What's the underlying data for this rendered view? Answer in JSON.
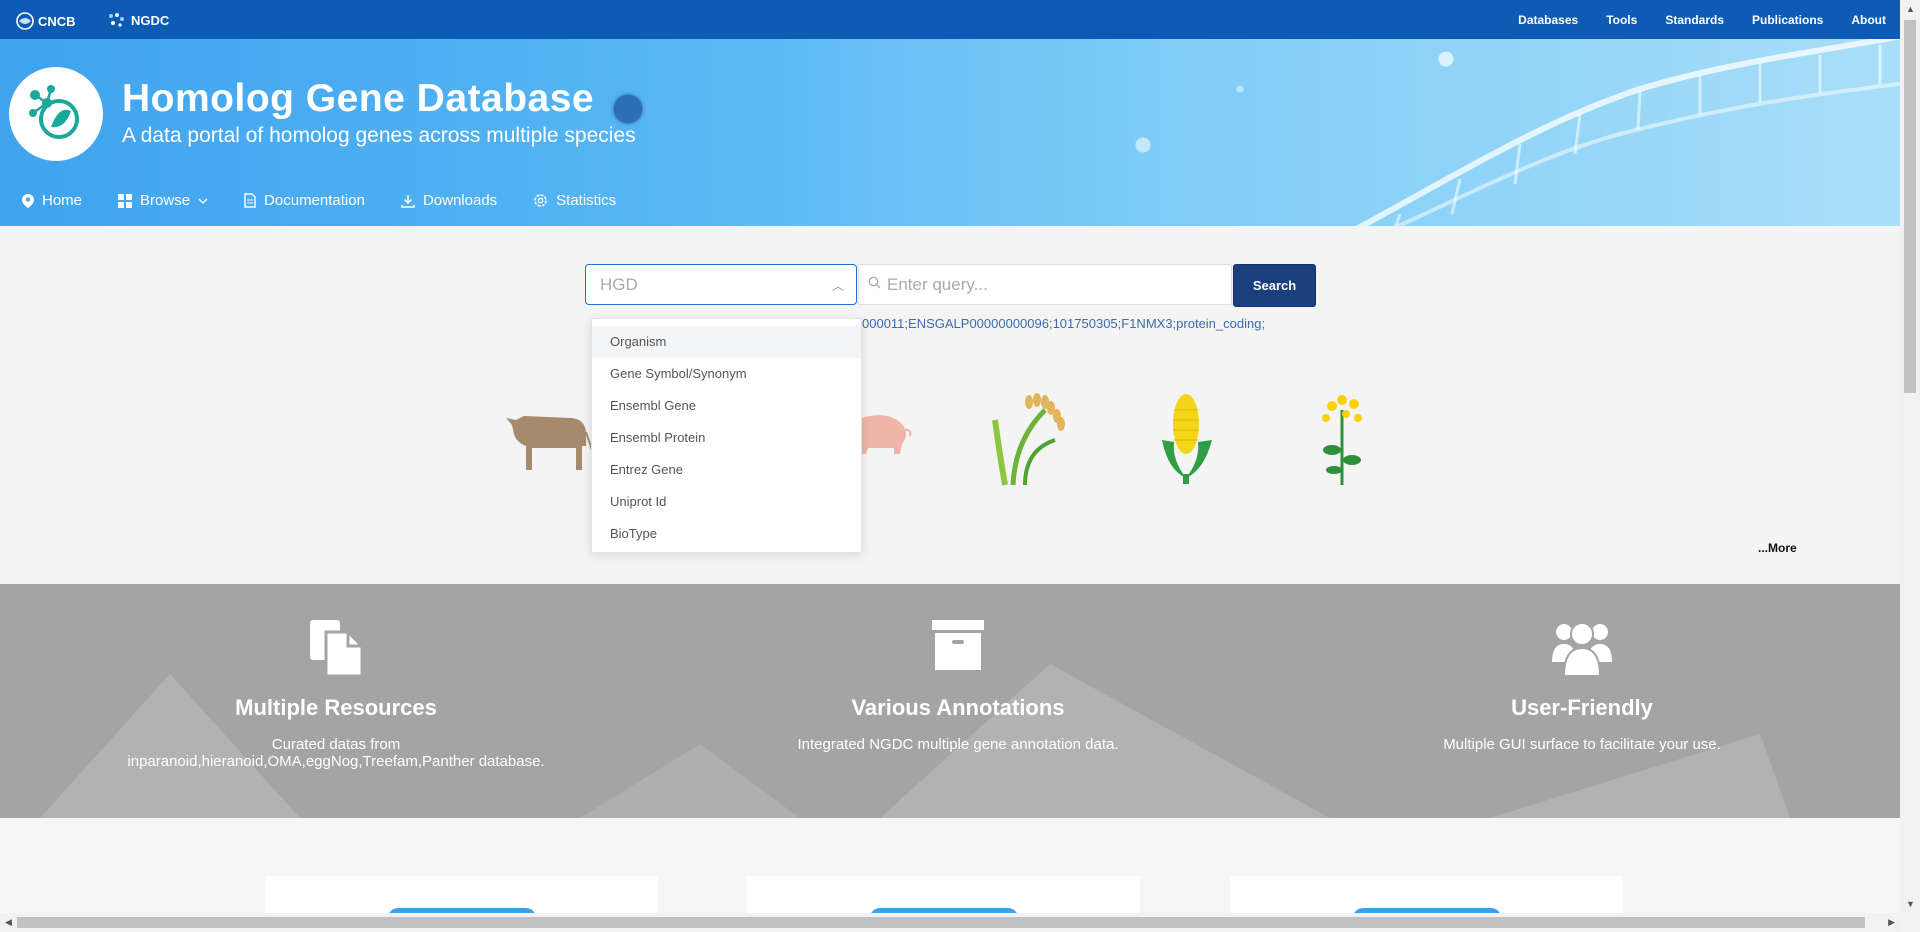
{
  "topbar": {
    "brand_cncb": "CNCB",
    "brand_ngdc": "NGDC",
    "links": [
      "Databases",
      "Tools",
      "Standards",
      "Publications",
      "About"
    ]
  },
  "banner": {
    "title": "Homolog Gene Database",
    "subtitle": "A data portal of homolog genes across multiple species"
  },
  "mainnav": {
    "home": "Home",
    "browse": "Browse",
    "documentation": "Documentation",
    "downloads": "Downloads",
    "statistics": "Statistics"
  },
  "search": {
    "select_value": "HGD",
    "query_placeholder": "Enter query...",
    "button_label": "Search",
    "example_text": "000011;ENSGALP00000000096;101750305;F1NMX3;protein_coding;"
  },
  "dropdown": {
    "options": [
      "Organism",
      "Gene Symbol/Synonym",
      "Ensembl Gene",
      "Ensembl Protein",
      "Entrez Gene",
      "Uniprot Id",
      "BioType"
    ],
    "highlighted": "Organism"
  },
  "species_more": "...More",
  "features": [
    {
      "title": "Multiple Resources",
      "desc_line1": "Curated datas from",
      "desc_line2": "inparanoid,hieranoid,OMA,eggNog,Treefam,Panther database.",
      "icon": "files-icon"
    },
    {
      "title": "Various Annotations",
      "desc_line1": "Integrated NGDC multiple gene annotation data.",
      "desc_line2": "",
      "icon": "archive-icon"
    },
    {
      "title": "User-Friendly",
      "desc_line1": "Multiple GUI surface to facilitate your use.",
      "desc_line2": "",
      "icon": "users-icon"
    }
  ],
  "colors": {
    "topbar": "#0d5bb5",
    "search_button": "#1a3f7c",
    "features_band": "#a4a4a4"
  }
}
